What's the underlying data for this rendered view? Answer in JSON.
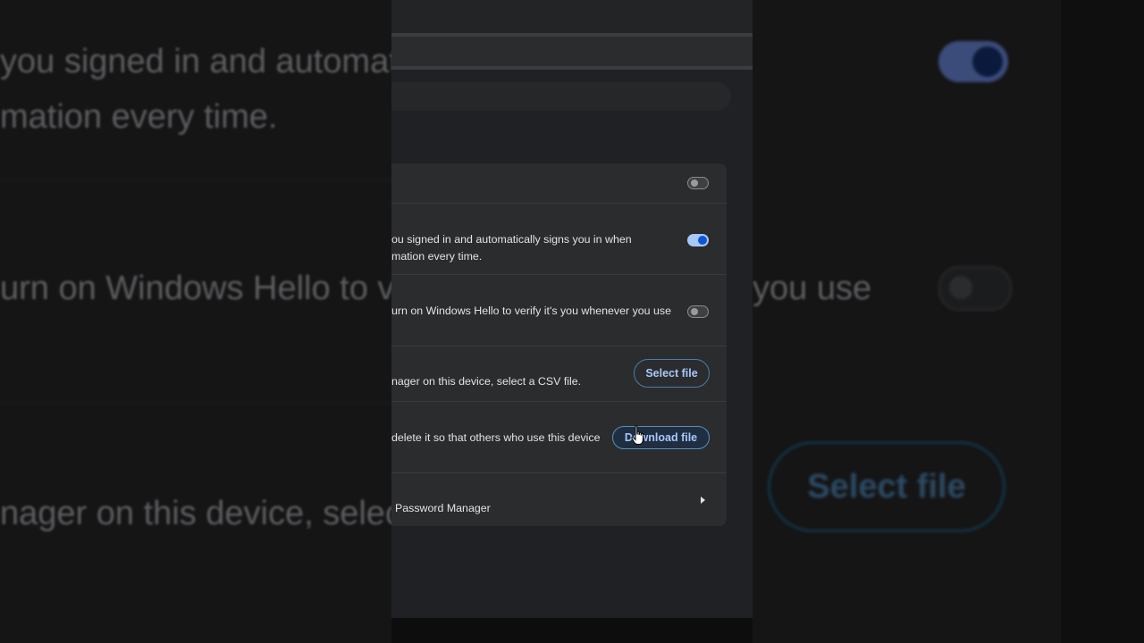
{
  "background": {
    "left_line1": "you signed in and automat",
    "left_line2": "mation every time.",
    "left_line3": "urn on Windows Hello to v",
    "left_line4": "nager on this device, selec",
    "right_line3": "you use",
    "right_button": "Select file"
  },
  "settings": {
    "rows": [
      {
        "text": "",
        "toggle": "off"
      },
      {
        "text_line1": "ou signed in and automatically signs you in when",
        "text_line2": "mation every time.",
        "toggle": "on"
      },
      {
        "text_line1": "urn on Windows Hello to verify it's you whenever you use",
        "toggle": "off"
      },
      {
        "text_line1": "nager on this device, select a CSV file.",
        "button": "Select file"
      },
      {
        "text_line1": "delete it so that others who use this device",
        "button": "Download file"
      },
      {
        "text_line1": "Password Manager"
      }
    ]
  },
  "colors": {
    "accent": "#a8c7fa",
    "toggle_on_knob": "#0b57d0",
    "card_bg": "#2b2c2e",
    "page_bg": "#202124"
  },
  "icons": {
    "row_chevron": "chevron-right-icon",
    "pointer": "hand-pointer-icon"
  }
}
